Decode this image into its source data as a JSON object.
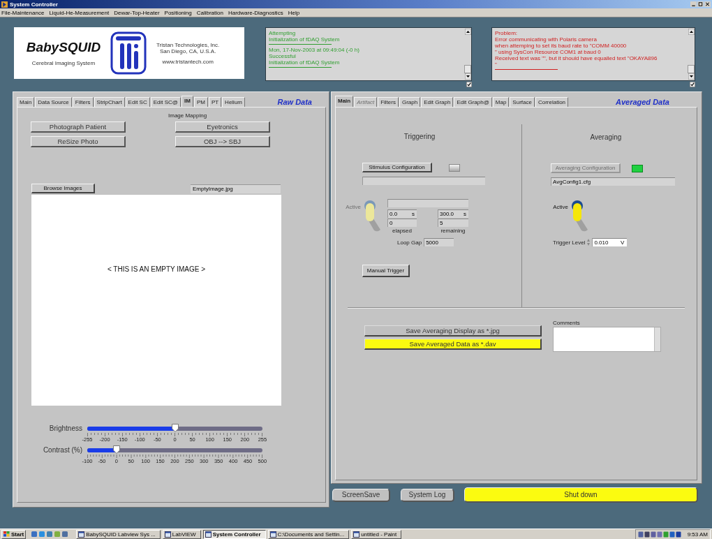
{
  "window": {
    "title": "System Controller"
  },
  "menu": [
    "File-Maintenance",
    "Liquid-He-Measurement",
    "Dewar-Top-Heater",
    "Positioning",
    "Calibration",
    "Hardware-Diagnostics",
    "Help"
  ],
  "header": {
    "product": "BabySQUID",
    "subtitle": "Cerebral Imaging System",
    "company": [
      "Tristan Technologies, Inc.",
      "San Diego, CA, U.S.A."
    ],
    "website": "www.tristantech.com"
  },
  "logs": [
    {
      "color": "#2f9e2f",
      "entries": [
        {
          "lines": [
            "Attempting",
            "Initialization of fDAQ System"
          ]
        },
        {
          "lines": [
            "Mon, 17-Nov-2003 at 09:49:04 (-0 h)",
            "Successful",
            "Initialization of fDAQ System"
          ]
        }
      ]
    },
    {
      "color": "#d02020",
      "entries": [
        {
          "lines": [
            "Problem:",
            "Error communicating with Polaris camera",
            "when attemping to set its baud rate to \"COMM 40000",
            "\" using SysCon Resource COM1 at baud 0",
            "Received text was \"\", but it should have equalled text \"OKAYA896",
            "\""
          ]
        }
      ]
    }
  ],
  "raw_panel": {
    "title": "Raw Data",
    "tabs": [
      {
        "label": "Main",
        "selected": false
      },
      {
        "label": "Data Source",
        "selected": false
      },
      {
        "label": "Filters",
        "selected": false
      },
      {
        "label": "StripChart",
        "selected": false
      },
      {
        "label": "Edit SC",
        "selected": false
      },
      {
        "label": "Edit SC@",
        "selected": false
      },
      {
        "label": "IM",
        "selected": true
      },
      {
        "label": "PM",
        "selected": false
      },
      {
        "label": "PT",
        "selected": false
      },
      {
        "label": "Helium",
        "selected": false
      }
    ],
    "section_label": "Image Mapping",
    "buttons": [
      "Photograph Patient",
      "Eyetronics",
      "ReSize Photo",
      "OBJ --> SBJ"
    ],
    "browse_button": "Browse Images",
    "file_field": {
      "value": "EmptyImage.jpg"
    },
    "image_message": "< THIS IS AN EMPTY IMAGE >",
    "sliders": [
      {
        "label": "Brightness",
        "level": 0.5,
        "scale": [
          "-255",
          "-200",
          "-150",
          "-100",
          "-50",
          "0",
          "50",
          "100",
          "150",
          "200",
          "255"
        ]
      },
      {
        "label": "Contrast (%)",
        "level": 0.167,
        "scale": [
          "-100",
          "-50",
          "0",
          "50",
          "100",
          "150",
          "200",
          "250",
          "300",
          "350",
          "400",
          "450",
          "500"
        ]
      }
    ]
  },
  "averaged_panel": {
    "title": "Averaged Data",
    "tabs": [
      {
        "label": "Main",
        "selected": true,
        "disabled": false
      },
      {
        "label": "Artifact",
        "selected": false,
        "disabled": true
      },
      {
        "label": "Filters",
        "selected": false,
        "disabled": false
      },
      {
        "label": "Graph",
        "selected": false,
        "disabled": false
      },
      {
        "label": "Edit Graph",
        "selected": false,
        "disabled": false
      },
      {
        "label": "Edit Graph@",
        "selected": false,
        "disabled": false
      },
      {
        "label": "Map",
        "selected": false,
        "disabled": false
      },
      {
        "label": "Surface",
        "selected": false,
        "disabled": false
      },
      {
        "label": "Correlation",
        "selected": false,
        "disabled": false
      }
    ],
    "triggering": {
      "title": "Triggering",
      "config_button": {
        "label": "Stimulus Configuration",
        "disabled": false
      },
      "led_on": false,
      "active": {
        "label": "Active",
        "on": false
      },
      "elapsed": {
        "time": "0.0",
        "unit": "s",
        "count": "0",
        "label": "elapsed"
      },
      "remaining": {
        "time": "300.0",
        "unit": "s",
        "count": "5",
        "label": "remaining"
      },
      "loop_gap": {
        "label": "Loop Gap",
        "value": "5000"
      },
      "manual_button": "Manual Trigger"
    },
    "averaging": {
      "title": "Averaging",
      "config_button": {
        "label": "Averaging Configuration",
        "disabled": true
      },
      "led_on": true,
      "config_field": {
        "value": "AvgConfig1.cfg"
      },
      "active": {
        "label": "Active",
        "on": true
      },
      "trigger_level": {
        "label": "Trigger Level",
        "value": "0.010",
        "unit": "V"
      }
    },
    "save_buttons": [
      {
        "label": "Save Averaging Display as *.jpg",
        "kind": "plain"
      },
      {
        "label": "Save Averaged Data as *.dav",
        "kind": "highlight"
      }
    ],
    "comments": {
      "label": "Comments"
    }
  },
  "bottom_buttons": [
    {
      "label": "ScreenSave",
      "kind": "plain"
    },
    {
      "label": "System Log",
      "kind": "plain"
    },
    {
      "label": "Shut down",
      "kind": "highlight"
    }
  ],
  "taskbar": {
    "start": "Start",
    "tasks": [
      {
        "label": "BabySQUID Labview Sys ...",
        "selected": false
      },
      {
        "label": "LabVIEW",
        "selected": false
      },
      {
        "label": "System Controller",
        "selected": true
      },
      {
        "label": "C:\\Documents and Settin...",
        "selected": false
      },
      {
        "label": "untitled - Paint",
        "selected": false
      }
    ],
    "clock": "9:53 AM"
  }
}
